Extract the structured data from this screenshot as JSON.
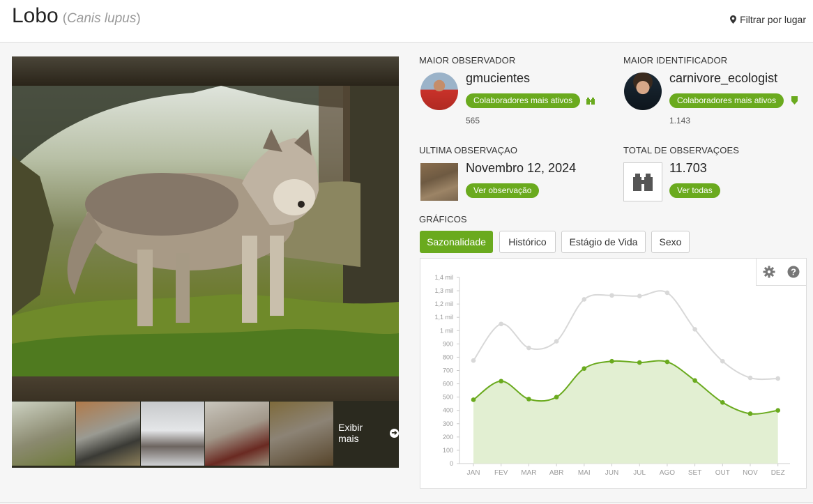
{
  "header": {
    "title": "Lobo",
    "scientific_name": "Canis lupus",
    "filter_label": "Filtrar por lugar"
  },
  "photos": {
    "more_label": "Exibir mais"
  },
  "top_observer": {
    "label": "MAIOR OBSERVADOR",
    "username": "gmucientes",
    "badge": "Colaboradores mais ativos",
    "count": "565"
  },
  "top_identifier": {
    "label": "MAIOR IDENTIFICADOR",
    "username": "carnivore_ecologist",
    "badge": "Colaboradores mais ativos",
    "count": "1.143"
  },
  "last_observation": {
    "label": "ULTIMA OBSERVAÇAO",
    "date": "Novembro 12, 2024",
    "button": "Ver observação"
  },
  "total_observations": {
    "label": "TOTAL DE OBSERVAÇOES",
    "value": "11.703",
    "button": "Ver todas"
  },
  "charts": {
    "label": "GRÁFICOS",
    "tabs": [
      "Sazonalidade",
      "Histórico",
      "Estágio de Vida",
      "Sexo"
    ],
    "active_tab": 0
  },
  "colors": {
    "accent": "#6aaa1e",
    "series_gray": "#d8d8d8",
    "area_fill": "#e2efd2"
  },
  "chart_data": {
    "type": "line",
    "categories": [
      "JAN",
      "FEV",
      "MAR",
      "ABR",
      "MAI",
      "JUN",
      "JUL",
      "AGO",
      "SET",
      "OUT",
      "NOV",
      "DEZ"
    ],
    "y_ticks": [
      "0",
      "100",
      "200",
      "300",
      "400",
      "500",
      "600",
      "700",
      "800",
      "900",
      "1 mil",
      "1,1 mil",
      "1,2 mil",
      "1,3 mil",
      "1,4 mil"
    ],
    "ylim": [
      0,
      1400
    ],
    "series": [
      {
        "values": [
          775,
          1050,
          870,
          920,
          1235,
          1265,
          1260,
          1285,
          1010,
          770,
          645,
          640
        ],
        "color": "#d8d8d8"
      },
      {
        "values": [
          480,
          620,
          485,
          500,
          715,
          770,
          760,
          765,
          625,
          460,
          375,
          400
        ],
        "color": "#6aaa1e",
        "fill": "#e2efd2"
      }
    ]
  }
}
